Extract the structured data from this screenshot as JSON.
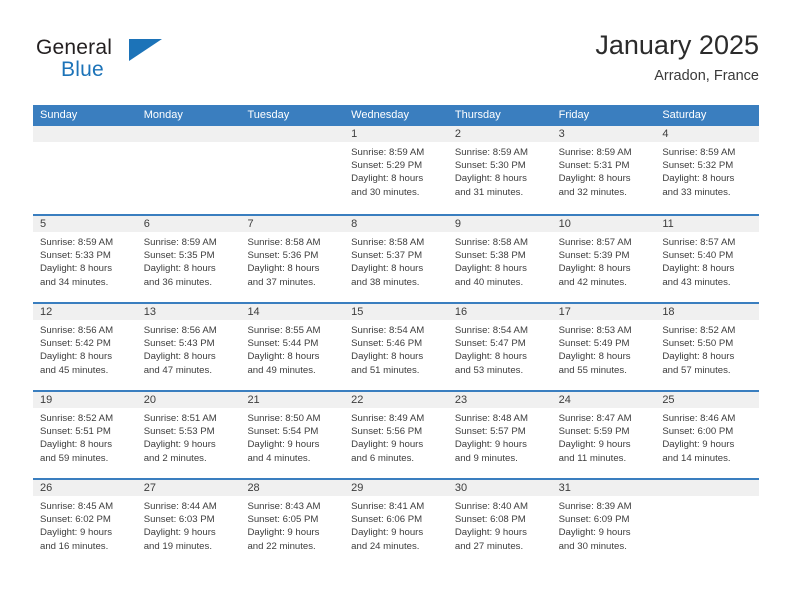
{
  "brand": {
    "name_part1": "General",
    "name_part2": "Blue",
    "flag_icon": "triangle-flag-icon",
    "accent_color": "#1c73b8"
  },
  "header": {
    "month_title": "January 2025",
    "location": "Arradon, France"
  },
  "calendar": {
    "header_color": "#3a7ebf",
    "date_band_color": "#f0f0f0",
    "day_names": [
      "Sunday",
      "Monday",
      "Tuesday",
      "Wednesday",
      "Thursday",
      "Friday",
      "Saturday"
    ],
    "weeks": [
      [
        {
          "empty": true
        },
        {
          "empty": true
        },
        {
          "empty": true
        },
        {
          "date": "1",
          "sunrise": "Sunrise: 8:59 AM",
          "sunset": "Sunset: 5:29 PM",
          "daylight_line1": "Daylight: 8 hours",
          "daylight_line2": "and 30 minutes."
        },
        {
          "date": "2",
          "sunrise": "Sunrise: 8:59 AM",
          "sunset": "Sunset: 5:30 PM",
          "daylight_line1": "Daylight: 8 hours",
          "daylight_line2": "and 31 minutes."
        },
        {
          "date": "3",
          "sunrise": "Sunrise: 8:59 AM",
          "sunset": "Sunset: 5:31 PM",
          "daylight_line1": "Daylight: 8 hours",
          "daylight_line2": "and 32 minutes."
        },
        {
          "date": "4",
          "sunrise": "Sunrise: 8:59 AM",
          "sunset": "Sunset: 5:32 PM",
          "daylight_line1": "Daylight: 8 hours",
          "daylight_line2": "and 33 minutes."
        }
      ],
      [
        {
          "date": "5",
          "sunrise": "Sunrise: 8:59 AM",
          "sunset": "Sunset: 5:33 PM",
          "daylight_line1": "Daylight: 8 hours",
          "daylight_line2": "and 34 minutes."
        },
        {
          "date": "6",
          "sunrise": "Sunrise: 8:59 AM",
          "sunset": "Sunset: 5:35 PM",
          "daylight_line1": "Daylight: 8 hours",
          "daylight_line2": "and 36 minutes."
        },
        {
          "date": "7",
          "sunrise": "Sunrise: 8:58 AM",
          "sunset": "Sunset: 5:36 PM",
          "daylight_line1": "Daylight: 8 hours",
          "daylight_line2": "and 37 minutes."
        },
        {
          "date": "8",
          "sunrise": "Sunrise: 8:58 AM",
          "sunset": "Sunset: 5:37 PM",
          "daylight_line1": "Daylight: 8 hours",
          "daylight_line2": "and 38 minutes."
        },
        {
          "date": "9",
          "sunrise": "Sunrise: 8:58 AM",
          "sunset": "Sunset: 5:38 PM",
          "daylight_line1": "Daylight: 8 hours",
          "daylight_line2": "and 40 minutes."
        },
        {
          "date": "10",
          "sunrise": "Sunrise: 8:57 AM",
          "sunset": "Sunset: 5:39 PM",
          "daylight_line1": "Daylight: 8 hours",
          "daylight_line2": "and 42 minutes."
        },
        {
          "date": "11",
          "sunrise": "Sunrise: 8:57 AM",
          "sunset": "Sunset: 5:40 PM",
          "daylight_line1": "Daylight: 8 hours",
          "daylight_line2": "and 43 minutes."
        }
      ],
      [
        {
          "date": "12",
          "sunrise": "Sunrise: 8:56 AM",
          "sunset": "Sunset: 5:42 PM",
          "daylight_line1": "Daylight: 8 hours",
          "daylight_line2": "and 45 minutes."
        },
        {
          "date": "13",
          "sunrise": "Sunrise: 8:56 AM",
          "sunset": "Sunset: 5:43 PM",
          "daylight_line1": "Daylight: 8 hours",
          "daylight_line2": "and 47 minutes."
        },
        {
          "date": "14",
          "sunrise": "Sunrise: 8:55 AM",
          "sunset": "Sunset: 5:44 PM",
          "daylight_line1": "Daylight: 8 hours",
          "daylight_line2": "and 49 minutes."
        },
        {
          "date": "15",
          "sunrise": "Sunrise: 8:54 AM",
          "sunset": "Sunset: 5:46 PM",
          "daylight_line1": "Daylight: 8 hours",
          "daylight_line2": "and 51 minutes."
        },
        {
          "date": "16",
          "sunrise": "Sunrise: 8:54 AM",
          "sunset": "Sunset: 5:47 PM",
          "daylight_line1": "Daylight: 8 hours",
          "daylight_line2": "and 53 minutes."
        },
        {
          "date": "17",
          "sunrise": "Sunrise: 8:53 AM",
          "sunset": "Sunset: 5:49 PM",
          "daylight_line1": "Daylight: 8 hours",
          "daylight_line2": "and 55 minutes."
        },
        {
          "date": "18",
          "sunrise": "Sunrise: 8:52 AM",
          "sunset": "Sunset: 5:50 PM",
          "daylight_line1": "Daylight: 8 hours",
          "daylight_line2": "and 57 minutes."
        }
      ],
      [
        {
          "date": "19",
          "sunrise": "Sunrise: 8:52 AM",
          "sunset": "Sunset: 5:51 PM",
          "daylight_line1": "Daylight: 8 hours",
          "daylight_line2": "and 59 minutes."
        },
        {
          "date": "20",
          "sunrise": "Sunrise: 8:51 AM",
          "sunset": "Sunset: 5:53 PM",
          "daylight_line1": "Daylight: 9 hours",
          "daylight_line2": "and 2 minutes."
        },
        {
          "date": "21",
          "sunrise": "Sunrise: 8:50 AM",
          "sunset": "Sunset: 5:54 PM",
          "daylight_line1": "Daylight: 9 hours",
          "daylight_line2": "and 4 minutes."
        },
        {
          "date": "22",
          "sunrise": "Sunrise: 8:49 AM",
          "sunset": "Sunset: 5:56 PM",
          "daylight_line1": "Daylight: 9 hours",
          "daylight_line2": "and 6 minutes."
        },
        {
          "date": "23",
          "sunrise": "Sunrise: 8:48 AM",
          "sunset": "Sunset: 5:57 PM",
          "daylight_line1": "Daylight: 9 hours",
          "daylight_line2": "and 9 minutes."
        },
        {
          "date": "24",
          "sunrise": "Sunrise: 8:47 AM",
          "sunset": "Sunset: 5:59 PM",
          "daylight_line1": "Daylight: 9 hours",
          "daylight_line2": "and 11 minutes."
        },
        {
          "date": "25",
          "sunrise": "Sunrise: 8:46 AM",
          "sunset": "Sunset: 6:00 PM",
          "daylight_line1": "Daylight: 9 hours",
          "daylight_line2": "and 14 minutes."
        }
      ],
      [
        {
          "date": "26",
          "sunrise": "Sunrise: 8:45 AM",
          "sunset": "Sunset: 6:02 PM",
          "daylight_line1": "Daylight: 9 hours",
          "daylight_line2": "and 16 minutes."
        },
        {
          "date": "27",
          "sunrise": "Sunrise: 8:44 AM",
          "sunset": "Sunset: 6:03 PM",
          "daylight_line1": "Daylight: 9 hours",
          "daylight_line2": "and 19 minutes."
        },
        {
          "date": "28",
          "sunrise": "Sunrise: 8:43 AM",
          "sunset": "Sunset: 6:05 PM",
          "daylight_line1": "Daylight: 9 hours",
          "daylight_line2": "and 22 minutes."
        },
        {
          "date": "29",
          "sunrise": "Sunrise: 8:41 AM",
          "sunset": "Sunset: 6:06 PM",
          "daylight_line1": "Daylight: 9 hours",
          "daylight_line2": "and 24 minutes."
        },
        {
          "date": "30",
          "sunrise": "Sunrise: 8:40 AM",
          "sunset": "Sunset: 6:08 PM",
          "daylight_line1": "Daylight: 9 hours",
          "daylight_line2": "and 27 minutes."
        },
        {
          "date": "31",
          "sunrise": "Sunrise: 8:39 AM",
          "sunset": "Sunset: 6:09 PM",
          "daylight_line1": "Daylight: 9 hours",
          "daylight_line2": "and 30 minutes."
        },
        {
          "empty": true
        }
      ]
    ]
  }
}
